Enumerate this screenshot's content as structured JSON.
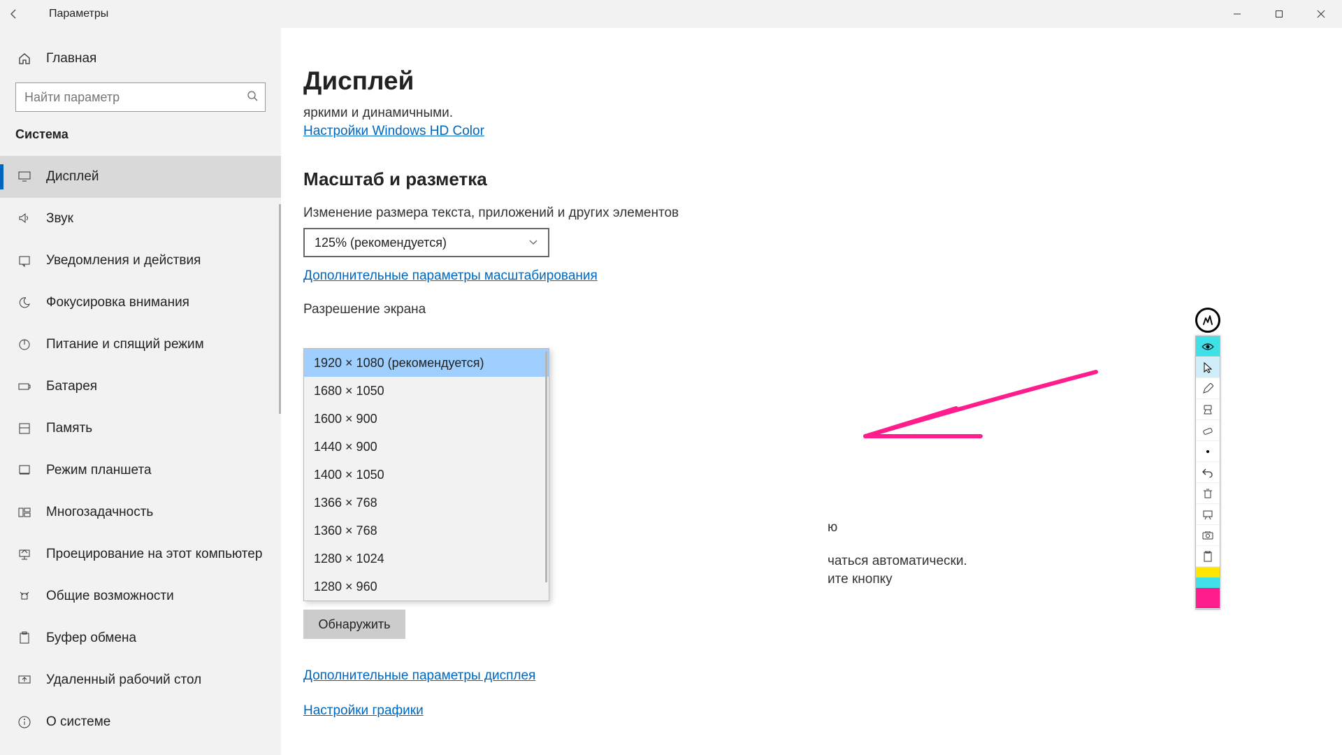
{
  "window": {
    "title": "Параметры"
  },
  "sidebar": {
    "home": "Главная",
    "search_placeholder": "Найти параметр",
    "category": "Система",
    "items": [
      {
        "label": "Дисплей",
        "icon": "monitor"
      },
      {
        "label": "Звук",
        "icon": "sound"
      },
      {
        "label": "Уведомления и действия",
        "icon": "notify"
      },
      {
        "label": "Фокусировка внимания",
        "icon": "moon"
      },
      {
        "label": "Питание и спящий режим",
        "icon": "power"
      },
      {
        "label": "Батарея",
        "icon": "battery"
      },
      {
        "label": "Память",
        "icon": "storage"
      },
      {
        "label": "Режим планшета",
        "icon": "tablet"
      },
      {
        "label": "Многозадачность",
        "icon": "multitask"
      },
      {
        "label": "Проецирование на этот компьютер",
        "icon": "project"
      },
      {
        "label": "Общие возможности",
        "icon": "shared"
      },
      {
        "label": "Буфер обмена",
        "icon": "clipboard"
      },
      {
        "label": "Удаленный рабочий стол",
        "icon": "remote"
      },
      {
        "label": "О системе",
        "icon": "info"
      }
    ]
  },
  "content": {
    "page_title": "Дисплей",
    "hdr_tail": "яркими и динамичными.",
    "hdr_link": "Настройки Windows HD Color",
    "scale_heading": "Масштаб и разметка",
    "scale_label": "Изменение размера текста, приложений и других элементов",
    "scale_value": "125% (рекомендуется)",
    "adv_scale_link": "Дополнительные параметры масштабирования",
    "resolution_label": "Разрешение экрана",
    "resolution_options": [
      "1920 × 1080 (рекомендуется)",
      "1680 × 1050",
      "1600 × 900",
      "1440 × 900",
      "1400 × 1050",
      "1366 × 768",
      "1360 × 768",
      "1280 × 1024",
      "1280 × 960"
    ],
    "partial_right_1": "ю",
    "partial_line_1": "чаться автоматически.",
    "partial_line_2": "ите кнопку",
    "detect_button": "Обнаружить",
    "adv_display_link": "Дополнительные параметры дисплея",
    "graphics_link": "Настройки графики"
  }
}
